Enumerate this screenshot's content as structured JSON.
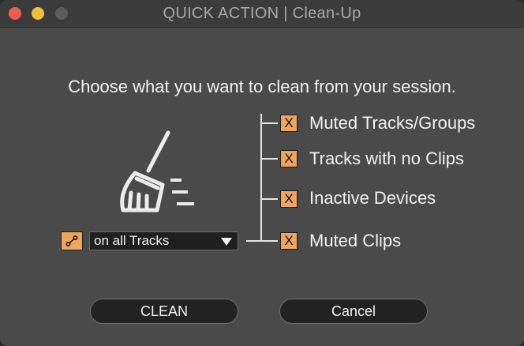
{
  "window": {
    "title": "QUICK ACTION | Clean-Up"
  },
  "dialog": {
    "prompt": "Choose what you want to clean from your session.",
    "options": [
      {
        "label": "Muted Tracks/Groups",
        "checked": true,
        "mark": "X"
      },
      {
        "label": "Tracks with no Clips",
        "checked": true,
        "mark": "X"
      },
      {
        "label": "Inactive Devices",
        "checked": true,
        "mark": "X"
      },
      {
        "label": "Muted Clips",
        "checked": true,
        "mark": "X"
      }
    ],
    "scope": {
      "selected": "on all Tracks",
      "link_icon": "link-icon"
    },
    "buttons": {
      "clean": "CLEAN",
      "cancel": "Cancel"
    }
  },
  "icons": {
    "main": "broom-icon"
  },
  "colors": {
    "accent": "#f0a55e",
    "background": "#4a4a4a",
    "text": "#f2f2f2"
  }
}
